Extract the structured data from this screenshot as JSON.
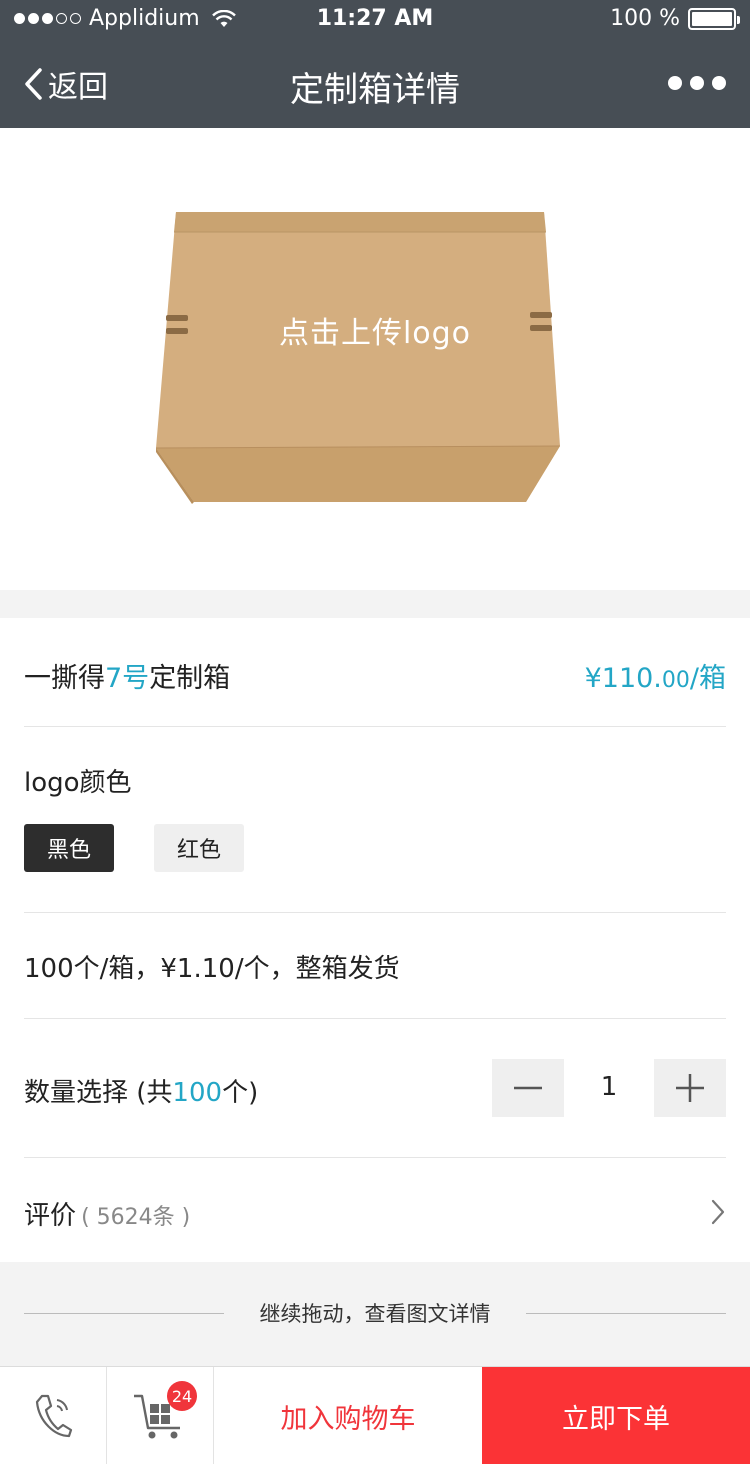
{
  "status_bar": {
    "carrier": "Applidium",
    "time": "11:27 AM",
    "battery": "100 %"
  },
  "nav": {
    "back_label": "返回",
    "title": "定制箱详情"
  },
  "product_image": {
    "upload_label": "点击上传logo"
  },
  "product": {
    "name_prefix": "一撕得",
    "name_accent": "7号",
    "name_suffix": "定制箱",
    "price_main": "¥110.",
    "price_cents": "00",
    "price_unit": "/箱"
  },
  "logo_color": {
    "label": "logo颜色",
    "options": [
      {
        "label": "黑色",
        "selected": true
      },
      {
        "label": "红色",
        "selected": false
      }
    ]
  },
  "spec_text": "100个/箱，¥1.10/个，整箱发货",
  "quantity": {
    "label_prefix": "数量选择 (共",
    "total": "100",
    "label_suffix": "个)",
    "value": "1"
  },
  "reviews": {
    "label": "评价",
    "count": "( 5624条 )"
  },
  "continue_text": "继续拖动，查看图文详情",
  "bottom_bar": {
    "cart_badge": "24",
    "add_to_cart": "加入购物车",
    "buy_now": "立即下单"
  },
  "colors": {
    "nav_bg": "#474e55",
    "accent": "#23a6c6",
    "primary_red": "#fb3336"
  }
}
